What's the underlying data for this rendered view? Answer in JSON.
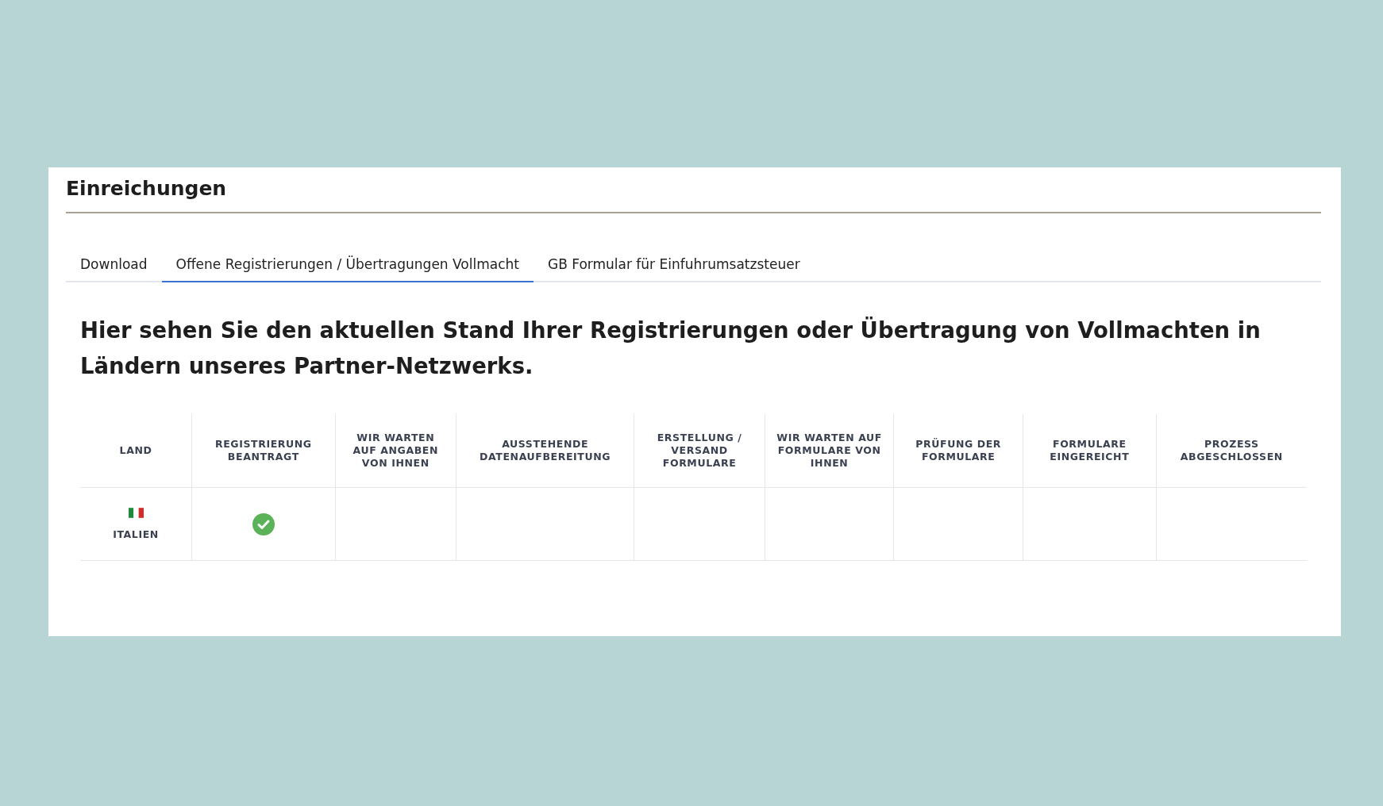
{
  "card": {
    "title": "Einreichungen"
  },
  "tabs": [
    {
      "label": "Download",
      "selected": false
    },
    {
      "label": "Offene Registrierungen / Übertragungen Vollmacht",
      "selected": true
    },
    {
      "label": "GB Formular für Einfuhrumsatzsteuer",
      "selected": false
    }
  ],
  "intro": "Hier sehen Sie den aktuellen Stand Ihrer Registrierungen oder Übertragung von Vollmachten in Ländern unseres Partner-Netzwerks.",
  "table": {
    "columns": [
      "LAND",
      "REGISTRIERUNG BEANTRAGT",
      "WIR WARTEN AUF ANGABEN VON IHNEN",
      "AUSSTEHENDE DATENAUFBEREITUNG",
      "ERSTELLUNG / VERSAND FORMULARE",
      "WIR WARTEN AUF FORMULARE VON IHNEN",
      "PRÜFUNG DER FORMULARE",
      "FORMULARE EINGEREICHT",
      "PROZESS ABGESCHLOSSEN"
    ],
    "rows": [
      {
        "country": "ITALIEN",
        "steps": [
          {
            "checked": true
          },
          {
            "checked": false
          },
          {
            "checked": false
          },
          {
            "checked": false
          },
          {
            "checked": false
          },
          {
            "checked": false
          },
          {
            "checked": false
          },
          {
            "checked": false
          }
        ]
      }
    ]
  }
}
